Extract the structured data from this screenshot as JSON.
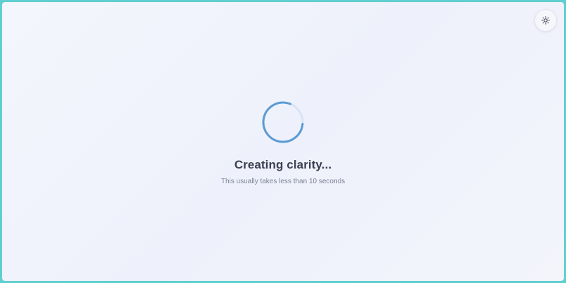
{
  "theme_toggle": {
    "icon": "sun-icon"
  },
  "loading": {
    "title": "Creating clarity...",
    "subtitle": "This usually takes less than 10 seconds",
    "spinner_color": "#5b9bd5",
    "spinner_track_color": "#d9e4f3"
  }
}
